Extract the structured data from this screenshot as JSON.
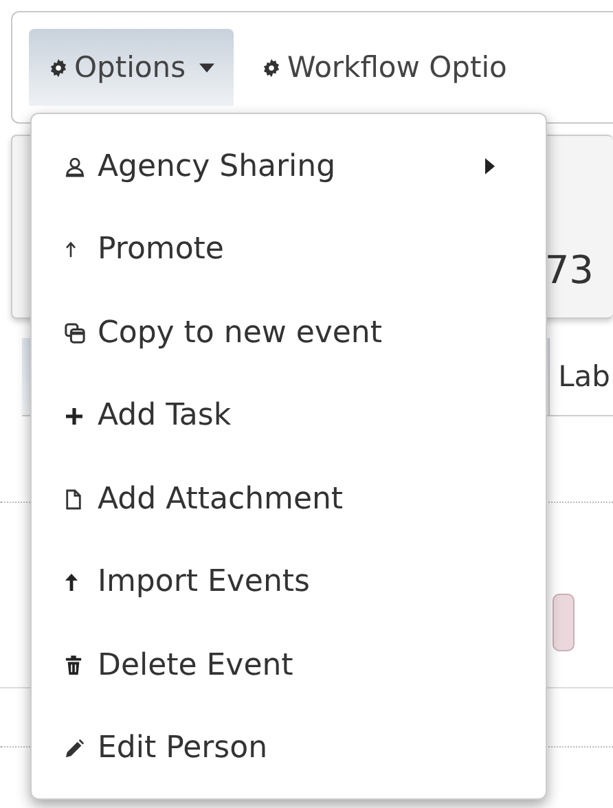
{
  "toolbar": {
    "buttons": [
      {
        "label": "Options",
        "selected": true,
        "has_caret": true
      },
      {
        "label": "Workflow Optio",
        "selected": false,
        "has_caret": false
      }
    ]
  },
  "background": {
    "number": "73",
    "tab": "Lab"
  },
  "menu": {
    "items": [
      {
        "label": "Agency Sharing",
        "has_submenu": true
      },
      {
        "label": "Promote",
        "has_submenu": false
      },
      {
        "label": "Copy to new event",
        "has_submenu": false
      },
      {
        "label": "Add Task",
        "has_submenu": false
      },
      {
        "label": "Add Attachment",
        "has_submenu": false
      },
      {
        "label": "Import Events",
        "has_submenu": false
      },
      {
        "label": "Delete Event",
        "has_submenu": false
      },
      {
        "label": "Edit Person",
        "has_submenu": false
      }
    ]
  }
}
